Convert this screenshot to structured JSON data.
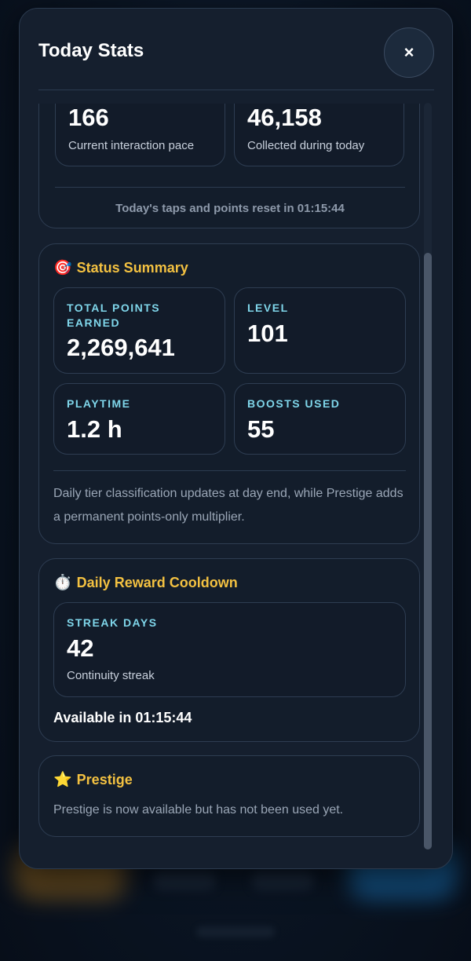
{
  "modal": {
    "title": "Today Stats",
    "close_label": "×"
  },
  "today": {
    "pace_value": "166",
    "pace_label": "Current interaction pace",
    "collected_value": "46,158",
    "collected_label": "Collected during today",
    "reset_text": "Today's taps and points reset in 01:15:44"
  },
  "status_summary": {
    "emoji": "🎯",
    "title": "Status Summary",
    "tiles": [
      {
        "label": "TOTAL POINTS EARNED",
        "value": "2,269,641"
      },
      {
        "label": "LEVEL",
        "value": "101"
      },
      {
        "label": "PLAYTIME",
        "value": "1.2 h"
      },
      {
        "label": "BOOSTS USED",
        "value": "55"
      }
    ],
    "note": "Daily tier classification updates at day end, while Prestige adds a permanent points-only multiplier."
  },
  "daily_reward": {
    "emoji": "⏱️",
    "title": "Daily Reward Cooldown",
    "streak_label": "STREAK DAYS",
    "streak_value": "42",
    "streak_sub": "Continuity streak",
    "available_text": "Available in 01:15:44"
  },
  "prestige": {
    "emoji": "⭐",
    "title": "Prestige",
    "text": "Prestige is now available but has not been used yet."
  },
  "colors": {
    "accent_title": "#f3c141",
    "tile_label": "#7fd6ea",
    "panel_bg": "#151f2e"
  }
}
